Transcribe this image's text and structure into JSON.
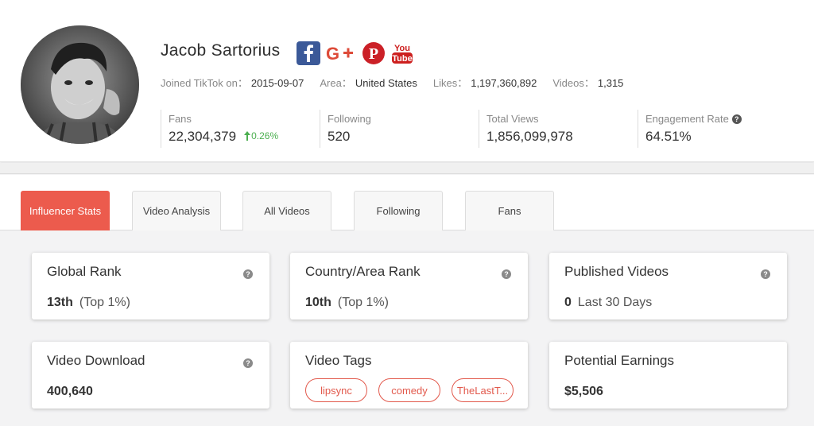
{
  "profile": {
    "name": "Jacob Sartorius",
    "joined_label": "Joined TikTok on：",
    "joined_value": "2015-09-07",
    "area_label": "Area：",
    "area_value": "United States",
    "likes_label": "Likes：",
    "likes_value": "1,197,360,892",
    "videos_label": "Videos：",
    "videos_value": "1,315",
    "socials": [
      "facebook-icon",
      "google-plus-icon",
      "pinterest-icon",
      "youtube-icon"
    ],
    "stats": [
      {
        "label": "Fans",
        "value": "22,304,379",
        "growth": "0.26%"
      },
      {
        "label": "Following",
        "value": "520"
      },
      {
        "label": "Total Views",
        "value": "1,856,099,978"
      },
      {
        "label": "Engagement Rate",
        "value": "64.51%"
      }
    ]
  },
  "tabs": [
    "Influencer Stats",
    "Video Analysis",
    "All Videos",
    "Following",
    "Fans"
  ],
  "active_tab": "Influencer Stats",
  "cards": {
    "global_rank": {
      "title": "Global Rank",
      "value": "13th",
      "note": "(Top 1%)"
    },
    "country_rank": {
      "title": "Country/Area Rank",
      "value": "10th",
      "note": "(Top 1%)"
    },
    "published": {
      "title": "Published Videos",
      "value": "0",
      "note": "Last 30 Days"
    },
    "download": {
      "title": "Video Download",
      "value": "400,640"
    },
    "tags": {
      "title": "Video Tags",
      "items": [
        "lipsync",
        "comedy",
        "TheLastT..."
      ]
    },
    "earnings": {
      "title": "Potential Earnings",
      "value": "$5,506"
    }
  },
  "colors": {
    "accent": "#ec5b4d",
    "growth": "#4caf50",
    "facebook": "#3b5998",
    "google": "#dd4b39",
    "pinterest": "#cb2027",
    "youtube": "#cd201f"
  }
}
